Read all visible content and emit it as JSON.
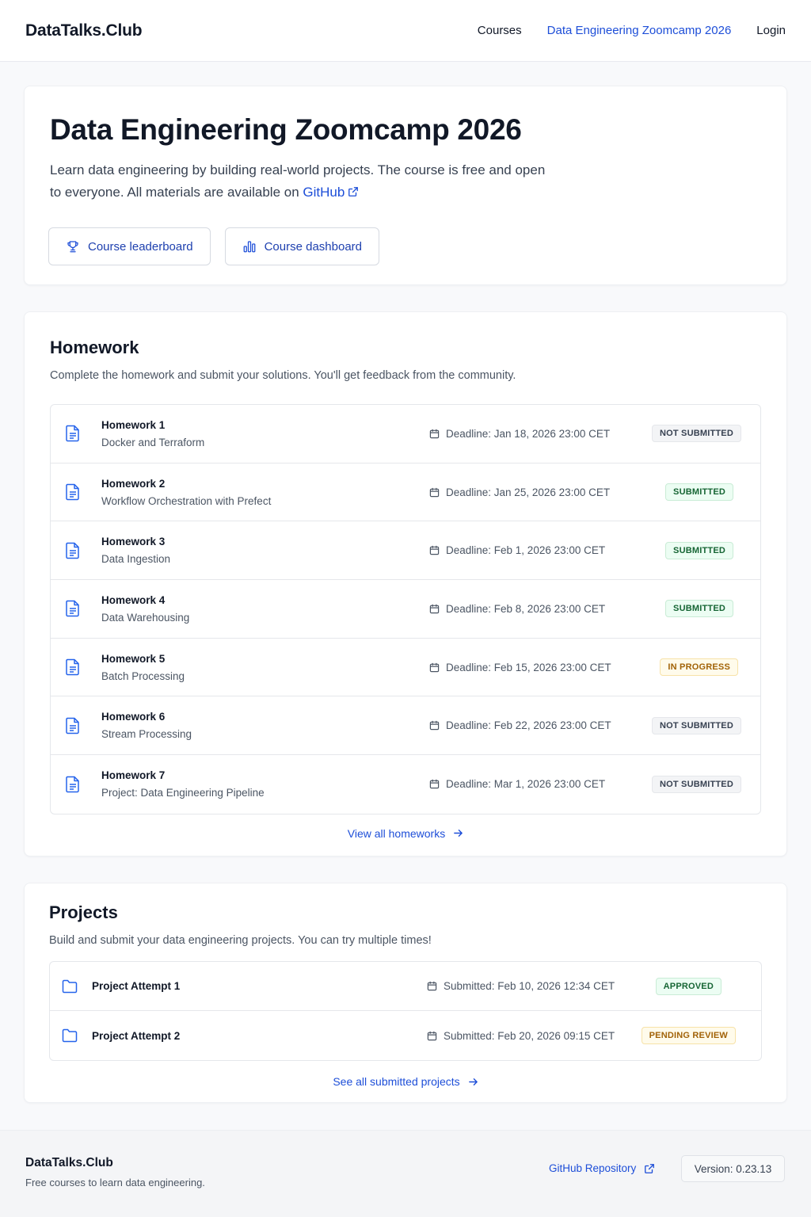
{
  "header": {
    "brand": "DataTalks.Club",
    "nav": {
      "courses": "Courses",
      "current_course": "Data Engineering Zoomcamp 2026",
      "login": "Login"
    }
  },
  "hero": {
    "title": "Data Engineering Zoomcamp 2026",
    "description": "Learn data engineering by building real-world projects. The course is free and open to everyone. All materials are available on",
    "github_link": "GitHub",
    "buttons": {
      "leaderboard": "Course leaderboard",
      "dashboard": "Course dashboard"
    }
  },
  "homework": {
    "title": "Homework",
    "subtitle": "Complete the homework and submit your solutions. You'll get feedback from the community.",
    "items": [
      {
        "title": "Homework 1",
        "description": "Docker and Terraform",
        "deadline": "Deadline: Jan 18, 2026 23:00 CET",
        "status": "NOT SUBMITTED"
      },
      {
        "title": "Homework 2",
        "description": "Workflow Orchestration with Prefect",
        "deadline": "Deadline: Jan 25, 2026 23:00 CET",
        "status": "SUBMITTED"
      },
      {
        "title": "Homework 3",
        "description": "Data Ingestion",
        "deadline": "Deadline: Feb 1, 2026 23:00 CET",
        "status": "SUBMITTED"
      },
      {
        "title": "Homework 4",
        "description": "Data Warehousing",
        "deadline": "Deadline: Feb 8, 2026 23:00 CET",
        "status": "SUBMITTED"
      },
      {
        "title": "Homework 5",
        "description": "Batch Processing",
        "deadline": "Deadline: Feb 15, 2026 23:00 CET",
        "status": "IN PROGRESS"
      },
      {
        "title": "Homework 6",
        "description": "Stream Processing",
        "deadline": "Deadline: Feb 22, 2026 23:00 CET",
        "status": "NOT SUBMITTED"
      },
      {
        "title": "Homework 7",
        "description": "Project: Data Engineering Pipeline",
        "deadline": "Deadline: Mar 1, 2026 23:00 CET",
        "status": "NOT SUBMITTED"
      }
    ],
    "view_all": "View all homeworks"
  },
  "projects": {
    "title": "Projects",
    "subtitle": "Build and submit your data engineering projects. You can try multiple times!",
    "items": [
      {
        "title": "Project Attempt 1",
        "submitted": "Submitted: Feb 10, 2026 12:34 CET",
        "status": "APPROVED"
      },
      {
        "title": "Project Attempt 2",
        "submitted": "Submitted: Feb 20, 2026 09:15 CET",
        "status": "PENDING REVIEW"
      }
    ],
    "view_all": "See all submitted projects"
  },
  "footer": {
    "brand": "DataTalks.Club",
    "tagline": "Free courses to learn data engineering.",
    "github_repo": "GitHub Repository",
    "version": "Version: 0.23.13"
  },
  "colors": {
    "accent": "#1d4ed8",
    "submitted": "#166534",
    "in_progress": "#a16207",
    "not_submitted": "#374151"
  }
}
